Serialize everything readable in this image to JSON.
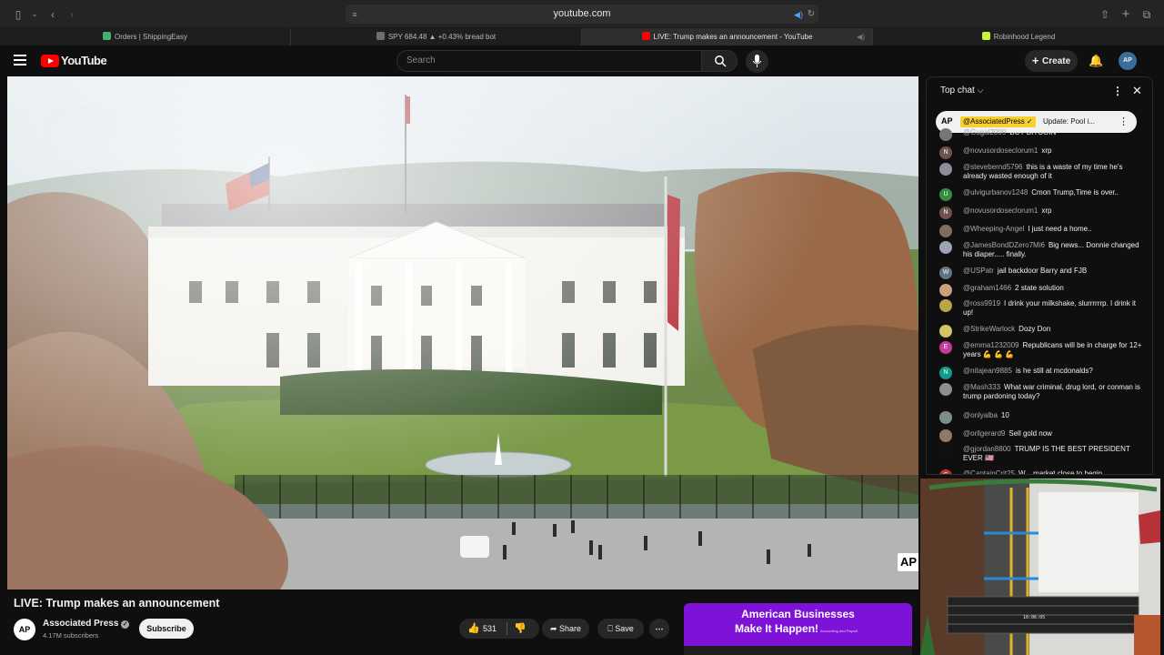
{
  "browser": {
    "url": "youtube.com",
    "tabs": [
      {
        "label": "Orders | ShippingEasy",
        "color": "#3fb36b",
        "active": false
      },
      {
        "label": "SPY 684.48 ▲ +0.43% bread bot",
        "color": "#6e6e6e",
        "active": false
      },
      {
        "label": "LIVE: Trump makes an announcement - YouTube",
        "color": "#ff0000",
        "active": true
      },
      {
        "label": "Robinhood Legend",
        "color": "#c8f33a",
        "active": false
      }
    ]
  },
  "header": {
    "logo_text": "YouTube",
    "search_placeholder": "Search",
    "create_label": "Create",
    "avatar_text": "AP"
  },
  "video": {
    "watermark": "AP",
    "title": "LIVE: Trump makes an announcement"
  },
  "channel": {
    "name": "Associated Press",
    "subscribers": "4.17M subscribers",
    "avatar_text": "AP",
    "subscribe_label": "Subscribe"
  },
  "actions": {
    "likes": "531",
    "share_label": "Share",
    "save_label": "Save"
  },
  "ad": {
    "line1": "American Businesses",
    "line2": "Make It Happen!",
    "tagline": "Accounting and Payroll"
  },
  "chat": {
    "mode_label": "Top chat",
    "pinned": {
      "author": "@AssociatedPress",
      "text": "Update: Pool i...",
      "avatar_text": "AP"
    },
    "messages": [
      {
        "author": "@Gugal2009",
        "text": "BUY BITCOIN",
        "avatar": "#777777",
        "initial": ""
      },
      {
        "author": "@novusordoseclorum1",
        "text": "xrp",
        "avatar": "#6b5548",
        "initial": "N"
      },
      {
        "author": "@stevebernd5796",
        "text": "this is a waste of my time he's already wasted enough of it",
        "avatar": "#8a8f96",
        "initial": ""
      },
      {
        "author": "@ulvigurbanov1248",
        "text": "Cmon Trump,Time is over..",
        "avatar": "#2f8f3a",
        "initial": "U"
      },
      {
        "author": "@novusordoseclorum1",
        "text": "xrp",
        "avatar": "#6b5548",
        "initial": "N"
      },
      {
        "author": "@Wheeping-Angel",
        "text": "I just need a home..",
        "avatar": "#7d6e5e",
        "initial": ""
      },
      {
        "author": "@JamesBondDZero7Mi6",
        "text": "Big news... Donnie changed his diaper..... finally.",
        "avatar": "#9aa3b5",
        "initial": ""
      },
      {
        "author": "@USPatr",
        "text": "jail backdoor Barry and FJB",
        "avatar": "#5f7480",
        "initial": "W"
      },
      {
        "author": "@graham1466",
        "text": "2 state solution",
        "avatar": "#c9a27a",
        "initial": ""
      },
      {
        "author": "@ross9919",
        "text": "I drink your milkshake, slurrrrrrp. I drink it up!",
        "avatar": "#b9a64a",
        "initial": ""
      },
      {
        "author": "@StrikeWarlock",
        "text": "Dozy Don",
        "avatar": "#d7c460",
        "initial": ""
      },
      {
        "author": "@emma1232009",
        "text": "Republicans will be in charge for 12+ years 💪 💪 💪",
        "avatar": "#c3399d",
        "initial": "E"
      },
      {
        "author": "@nitajean9885",
        "text": "is he still at mcdonalds?",
        "avatar": "#129c8c",
        "initial": "N"
      },
      {
        "author": "@Mash333",
        "text": "What war criminal, drug lord, or conman is trump pardoning today?",
        "avatar": "#8f8f8f",
        "initial": ""
      },
      {
        "author": "@onlyalba",
        "text": "10",
        "avatar": "#7b8f86",
        "initial": ""
      },
      {
        "author": "@orllgerard9",
        "text": "Sell gold now",
        "avatar": "#8d7c63",
        "initial": ""
      },
      {
        "author": "@gjordan8800",
        "text": "TRUMP IS THE BEST PRESIDENT EVER 🇺🇸",
        "avatar": "#111111",
        "initial": ""
      },
      {
        "author": "@CaptainCrit25",
        "text": "W... market close to begin",
        "avatar": "#c0392b",
        "initial": "C"
      }
    ]
  },
  "pip": {
    "sign": "10:06:05"
  }
}
